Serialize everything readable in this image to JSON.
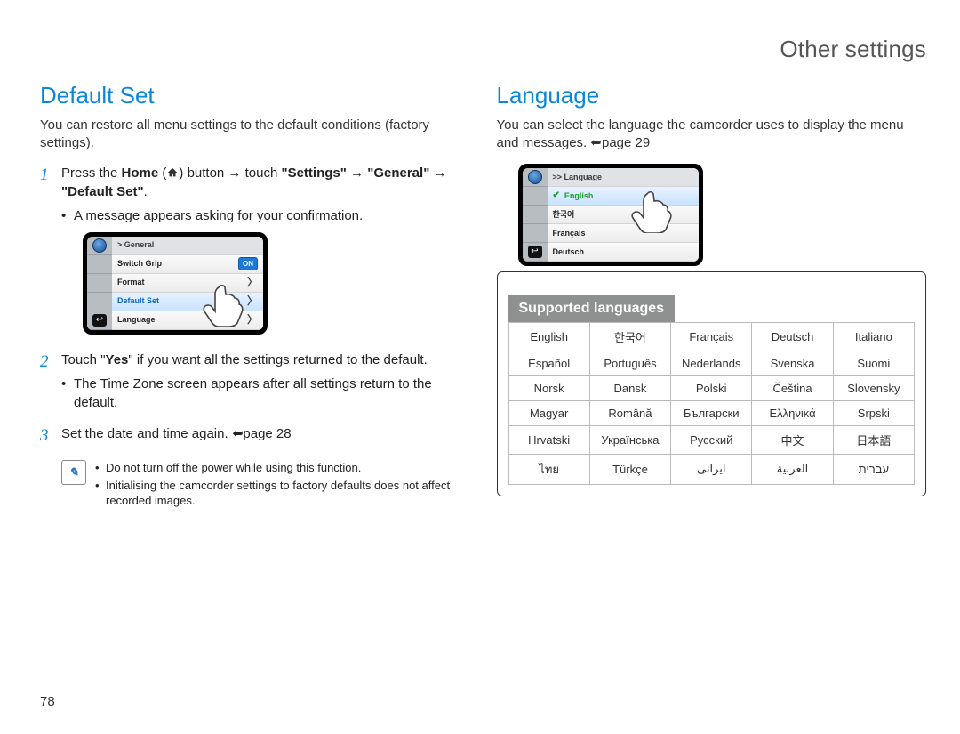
{
  "header": {
    "title": "Other settings"
  },
  "page_number": "78",
  "left": {
    "heading": "Default Set",
    "intro": "You can restore all menu settings to the default conditions (factory settings).",
    "step1_prefix": "Press the ",
    "step1_home_word": "Home",
    "step1_mid": " button → touch ",
    "step1_settings": "\"Settings\"",
    "step1_general": "\"General\"",
    "step1_default": "\"Default Set\"",
    "step1_bullet": "A message appears asking for your confirmation.",
    "step2_prefix": "Touch \"",
    "step2_yes": "Yes",
    "step2_suffix": "\" if you want all the settings returned to the default.",
    "step2_bullet": "The Time Zone screen appears after all settings return to the default.",
    "step3": "Set the date and time again. ",
    "step3_ref": "page 28",
    "notes": [
      "Do not turn off the power while using this function.",
      "Initialising the camcorder settings to factory defaults does not affect recorded images."
    ],
    "mock": {
      "breadcrumb": "> General",
      "rows": [
        {
          "label": "Switch Grip",
          "right": "ON"
        },
        {
          "label": "Format",
          "chev": true
        },
        {
          "label": "Default Set",
          "chev": true,
          "hi": true
        },
        {
          "label": "Language",
          "chev": true
        }
      ]
    }
  },
  "right": {
    "heading": "Language",
    "intro": "You can select the language the camcorder uses to display the menu and messages. ",
    "intro_ref": "page 29",
    "mock": {
      "breadcrumb": ">> Language",
      "rows": [
        {
          "label": "English",
          "check": true,
          "hi": true
        },
        {
          "label": "한국어"
        },
        {
          "label": "Français"
        },
        {
          "label": "Deutsch"
        }
      ]
    },
    "supported_heading": "Supported languages",
    "languages": [
      [
        "English",
        "한국어",
        "Français",
        "Deutsch",
        "Italiano"
      ],
      [
        "Español",
        "Português",
        "Nederlands",
        "Svenska",
        "Suomi"
      ],
      [
        "Norsk",
        "Dansk",
        "Polski",
        "Čeština",
        "Slovensky"
      ],
      [
        "Magyar",
        "Română",
        "Български",
        "Ελληνικά",
        "Srpski"
      ],
      [
        "Hrvatski",
        "Українська",
        "Русский",
        "中文",
        "日本語"
      ],
      [
        "ไทย",
        "Türkçe",
        "ايرانى",
        "العربية",
        "עברית"
      ]
    ]
  }
}
